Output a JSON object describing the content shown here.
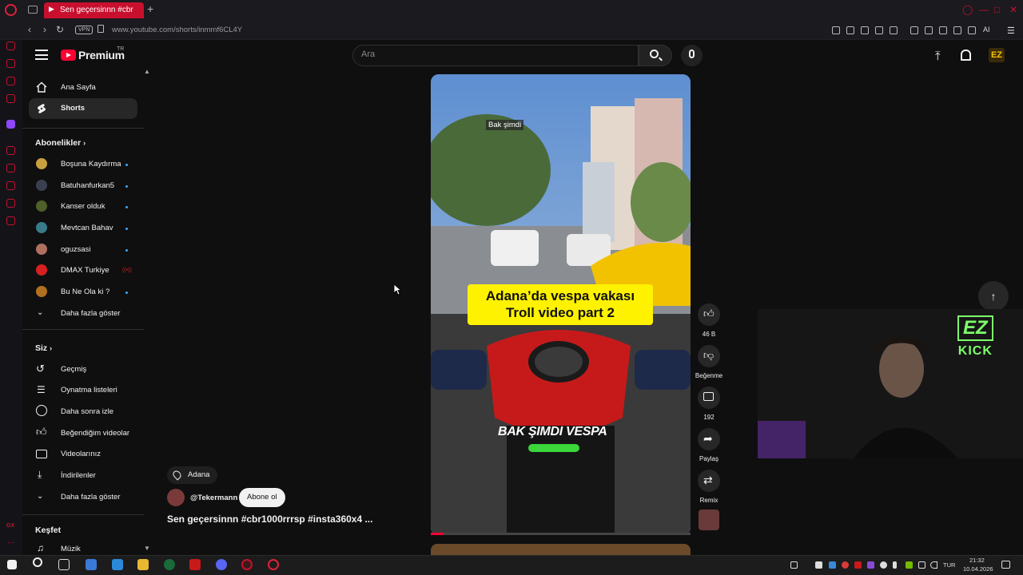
{
  "browser": {
    "tab_title": "Sen geçersinnn #cbr",
    "new_tab_glyph": "+",
    "url": "www.youtube.com/shorts/inmmf6CL4Y",
    "vpn_label": "VPN",
    "ai_label": "AI",
    "accent": "#c8102e"
  },
  "header": {
    "logo_text": "Premium",
    "region": "TR",
    "search_placeholder": "Ara"
  },
  "sidebar": {
    "main_items": [
      {
        "label": "Ana Sayfa",
        "icon": "home-icon"
      },
      {
        "label": "Shorts",
        "icon": "shorts-icon"
      }
    ],
    "subscriptions_title": "Abonelikler",
    "subscriptions": [
      {
        "label": "Boşuna Kaydırma",
        "color": "#c8a040"
      },
      {
        "label": "Batuhanfurkan5",
        "color": "#3a4050"
      },
      {
        "label": "Kanser olduk",
        "color": "#50602a"
      },
      {
        "label": "Mevtcan Bahav",
        "color": "#3a7a8a"
      },
      {
        "label": "oguzsasi",
        "color": "#b07060"
      },
      {
        "label": "DMAX Turkiye",
        "color": "#d82020"
      },
      {
        "label": "Bu Ne Ola ki ?",
        "color": "#b07020"
      }
    ],
    "show_more": "Daha fazla göster",
    "you_title": "Siz",
    "you_items": [
      {
        "label": "Geçmiş",
        "icon": "history-icon"
      },
      {
        "label": "Oynatma listeleri",
        "icon": "playlists-icon"
      },
      {
        "label": "Daha sonra izle",
        "icon": "watch-later-icon"
      },
      {
        "label": "Beğendiğim videolar",
        "icon": "liked-videos-icon"
      },
      {
        "label": "Videolarınız",
        "icon": "your-videos-icon"
      },
      {
        "label": "İndirilenler",
        "icon": "downloads-icon"
      }
    ],
    "show_more_2": "Daha fazla göster",
    "explore_title": "Keşfet",
    "explore_items": [
      {
        "label": "Müzik",
        "icon": "music-icon"
      }
    ]
  },
  "video": {
    "tag": "Bak şimdi",
    "caption_line1": "Adana’da vespa vakası",
    "caption_line2": "Troll video part 2",
    "overlay": "BAK ŞIMDI VESPA",
    "progress": 0.05
  },
  "actions": {
    "like_count": "46 B",
    "dislike_label": "Beğenme",
    "comment_count": "192",
    "share_label": "Paylaş",
    "remix_label": "Remix"
  },
  "meta": {
    "location": "Adana",
    "channel": "@Tekermann",
    "subscribe": "Abone ol",
    "title": "Sen geçersinnn #cbr1000rrrsp #insta360x4 ..."
  },
  "stream": {
    "logo_top": "EZ",
    "logo_bottom": "KICK",
    "logo_color": "#7dff6b"
  },
  "taskbar": {
    "lang": "TUR",
    "time": "21:32",
    "date": "10.04.2026"
  }
}
